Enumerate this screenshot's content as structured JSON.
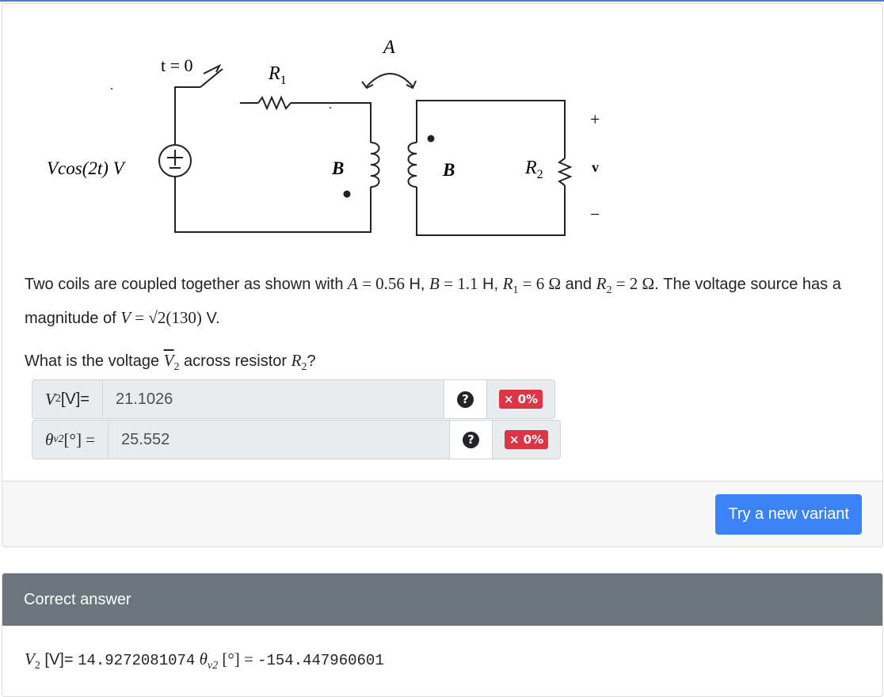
{
  "circuit": {
    "switch_label": "t = 0",
    "r1_label": "R",
    "r1_sub": "1",
    "r2_label": "R",
    "r2_sub": "2",
    "mutual_label": "A",
    "coil1_label": "B",
    "coil2_label": "B",
    "source_label": "Vcos(2t) V",
    "source_plus": "+",
    "source_minus": "−",
    "v_plus": "+",
    "v_label": "v",
    "v_minus": "−"
  },
  "question": {
    "p1_a": "Two coils are coupled together as shown with ",
    "A_sym": "A",
    "A_val": " = 0.56",
    "unit_H1": " H, ",
    "B_sym": "B",
    "B_val": " = 1.1",
    "unit_H2": " H, ",
    "R1_sym": "R",
    "R1_sub": "1",
    "R1_val": " = 6 Ω",
    "and": " and ",
    "R2_sym": "R",
    "R2_sub": "2",
    "R2_val": " = 2 Ω",
    "p1_b": ". The voltage source has a magnitude of ",
    "V_sym": "V",
    "V_val": " = √2(130)",
    "V_unit": " V.",
    "p2_a": "What is the voltage ",
    "V2_sym": "V",
    "V2_sub": "2",
    "p2_b": " across resistor ",
    "R2b_sym": "R",
    "R2b_sub": "2",
    "p2_c": "?"
  },
  "inputs": {
    "v2": {
      "label_sym": "V",
      "label_sub": "2",
      "label_rest": "[V]=",
      "value": "21.1026",
      "help": "?",
      "score": "× 0%"
    },
    "theta": {
      "label_sym": "θ",
      "label_sub": "v2",
      "label_rest": " [°] =",
      "value": "25.552",
      "help": "?",
      "score": "× 0%"
    }
  },
  "footer": {
    "button": "Try a new variant"
  },
  "answer": {
    "header": "Correct answer",
    "v2_sym": "V",
    "v2_sub": "2",
    "v2_unit": " [V]= ",
    "v2_value": "14.9272081074",
    "theta_sym": " θ",
    "theta_sub": "v2",
    "theta_unit": " [°] = ",
    "theta_value": "-154.447960601"
  },
  "colors": {
    "primary": "#3b82f6",
    "danger": "#dc3545",
    "header_gray": "#6c757d",
    "accent_top": "#4a7fd6"
  }
}
